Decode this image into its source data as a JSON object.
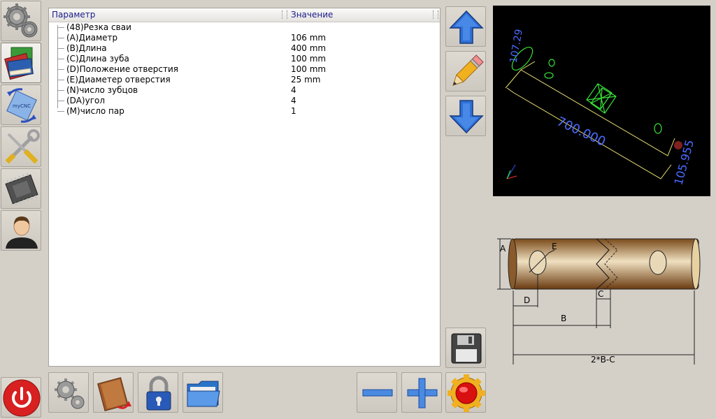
{
  "table": {
    "header_param": "Параметр",
    "header_value": "Значение",
    "rows": [
      {
        "label": "(48)Резка сваи",
        "value": ""
      },
      {
        "label": "(A)Диаметр",
        "value": "106 mm"
      },
      {
        "label": "(B)Длина",
        "value": "400 mm"
      },
      {
        "label": "(C)Длина зуба",
        "value": "100 mm"
      },
      {
        "label": "(D)Положение отверстия",
        "value": "100 mm"
      },
      {
        "label": "(E)Диаметер отверстия",
        "value": "25 mm"
      },
      {
        "label": "(N)число зубцов",
        "value": "4"
      },
      {
        "label": "(DA)угол",
        "value": "4"
      },
      {
        "label": "(M)число пар",
        "value": "1"
      }
    ]
  },
  "sidebar": {
    "items": [
      {
        "icon": "gears-icon"
      },
      {
        "icon": "books-icon"
      },
      {
        "icon": "mycnc-rotate-icon",
        "text": "myCNC"
      },
      {
        "icon": "tools-icon"
      },
      {
        "icon": "chip-icon"
      },
      {
        "icon": "user-icon"
      }
    ]
  },
  "preview": {
    "dim_left": "107.29",
    "dim_length": "700.000",
    "dim_right": "105.955"
  },
  "sketch": {
    "label_a": "A",
    "label_e": "E",
    "label_c": "C",
    "label_d": "D",
    "label_b": "B",
    "label_total": "2*B-C"
  },
  "colors": {
    "accent_blue": "#2f6fd6",
    "header_text": "#1a1a8c",
    "power_red": "#d82020"
  }
}
